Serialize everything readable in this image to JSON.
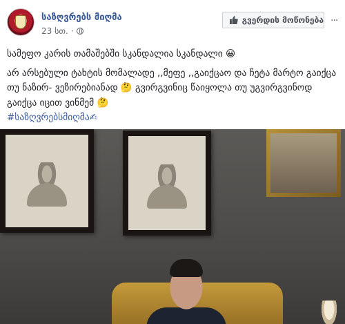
{
  "post": {
    "page_name": "საზღვრებს მიღმა",
    "time": "23 სთ.",
    "like_page_label": "გვერდის მოწონება",
    "more_label": "···",
    "lines": [
      "სამეფო კარის თამაშებში სკანდალია სკანდალი 😀",
      "არ არსებული ტახტის მომალადე ,,მეფე ,,გაიქცაო და ჩეტა მარტო გაიქცა",
      "თუ ნაზირ- ვეზირებიანად 🤔 გვირგვინიც წაიყოლა თუ უგვირგვინოდ",
      "გაიქცა იცით ვინმემ 🤔"
    ],
    "hashtag": "#საზღვრებსმიღმა✍"
  }
}
